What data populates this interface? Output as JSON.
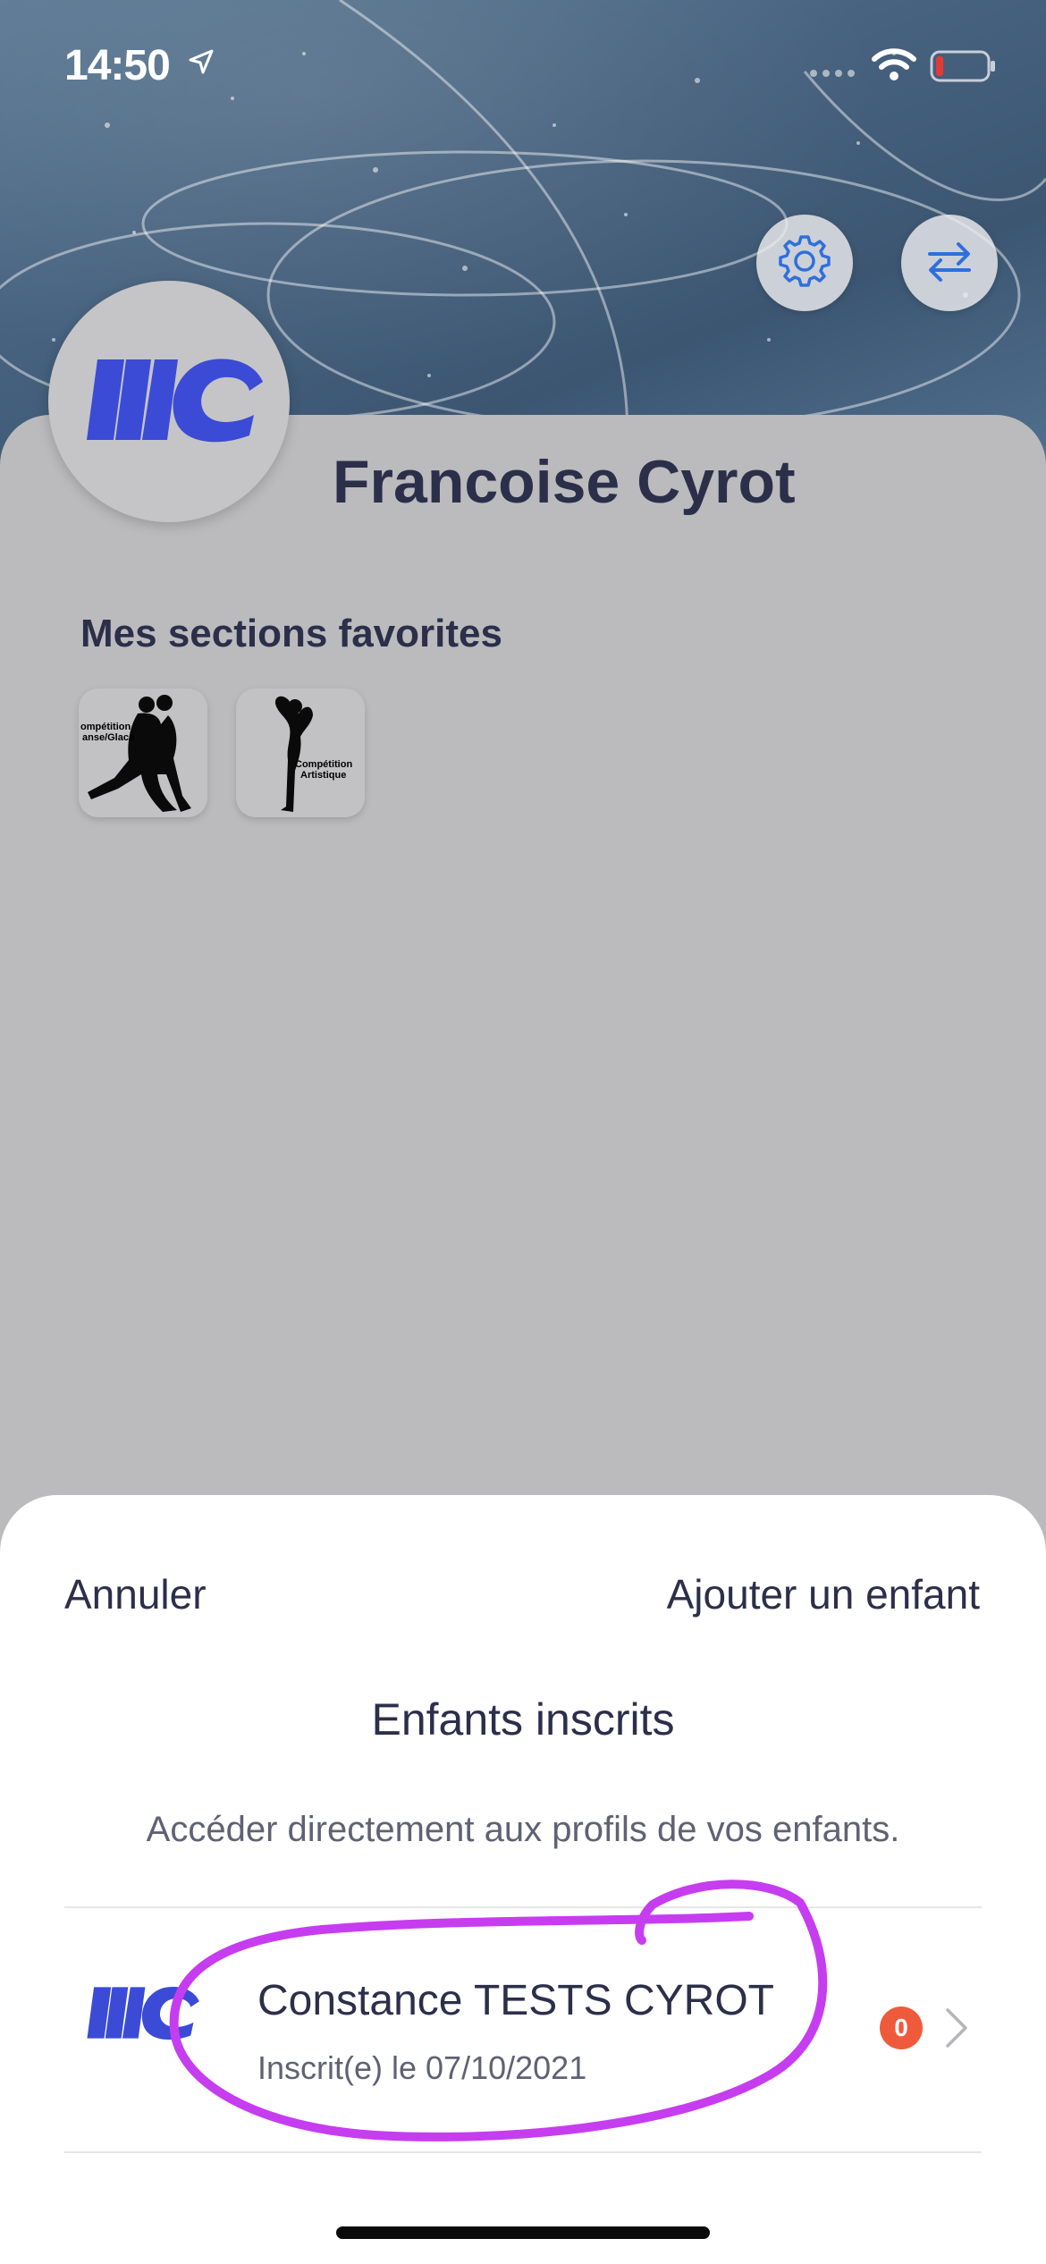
{
  "status_bar": {
    "time": "14:50",
    "battery_color": "#e53935"
  },
  "header": {
    "settings_icon": "gear-icon",
    "switch_icon": "swap-arrows-icon",
    "accent_color": "#2f6fdc"
  },
  "profile": {
    "name": "Francoise Cyrot",
    "logo_text": "MC",
    "logo_color": "#3b4bd6"
  },
  "favorites": {
    "title": "Mes sections favorites",
    "items": [
      {
        "label_line1": "ompétition",
        "label_line2": "anse/Glace"
      },
      {
        "label_line1": "Compétition",
        "label_line2": "Artistique"
      }
    ]
  },
  "sheet": {
    "cancel_label": "Annuler",
    "add_child_label": "Ajouter un enfant",
    "title": "Enfants inscrits",
    "subtitle": "Accéder directement aux profils de vos enfants.",
    "children": [
      {
        "name": "Constance TESTS CYROT",
        "date": "Inscrit(e) le 07/10/2021",
        "badge": "0"
      }
    ]
  },
  "annotation_color": "#c63df0"
}
